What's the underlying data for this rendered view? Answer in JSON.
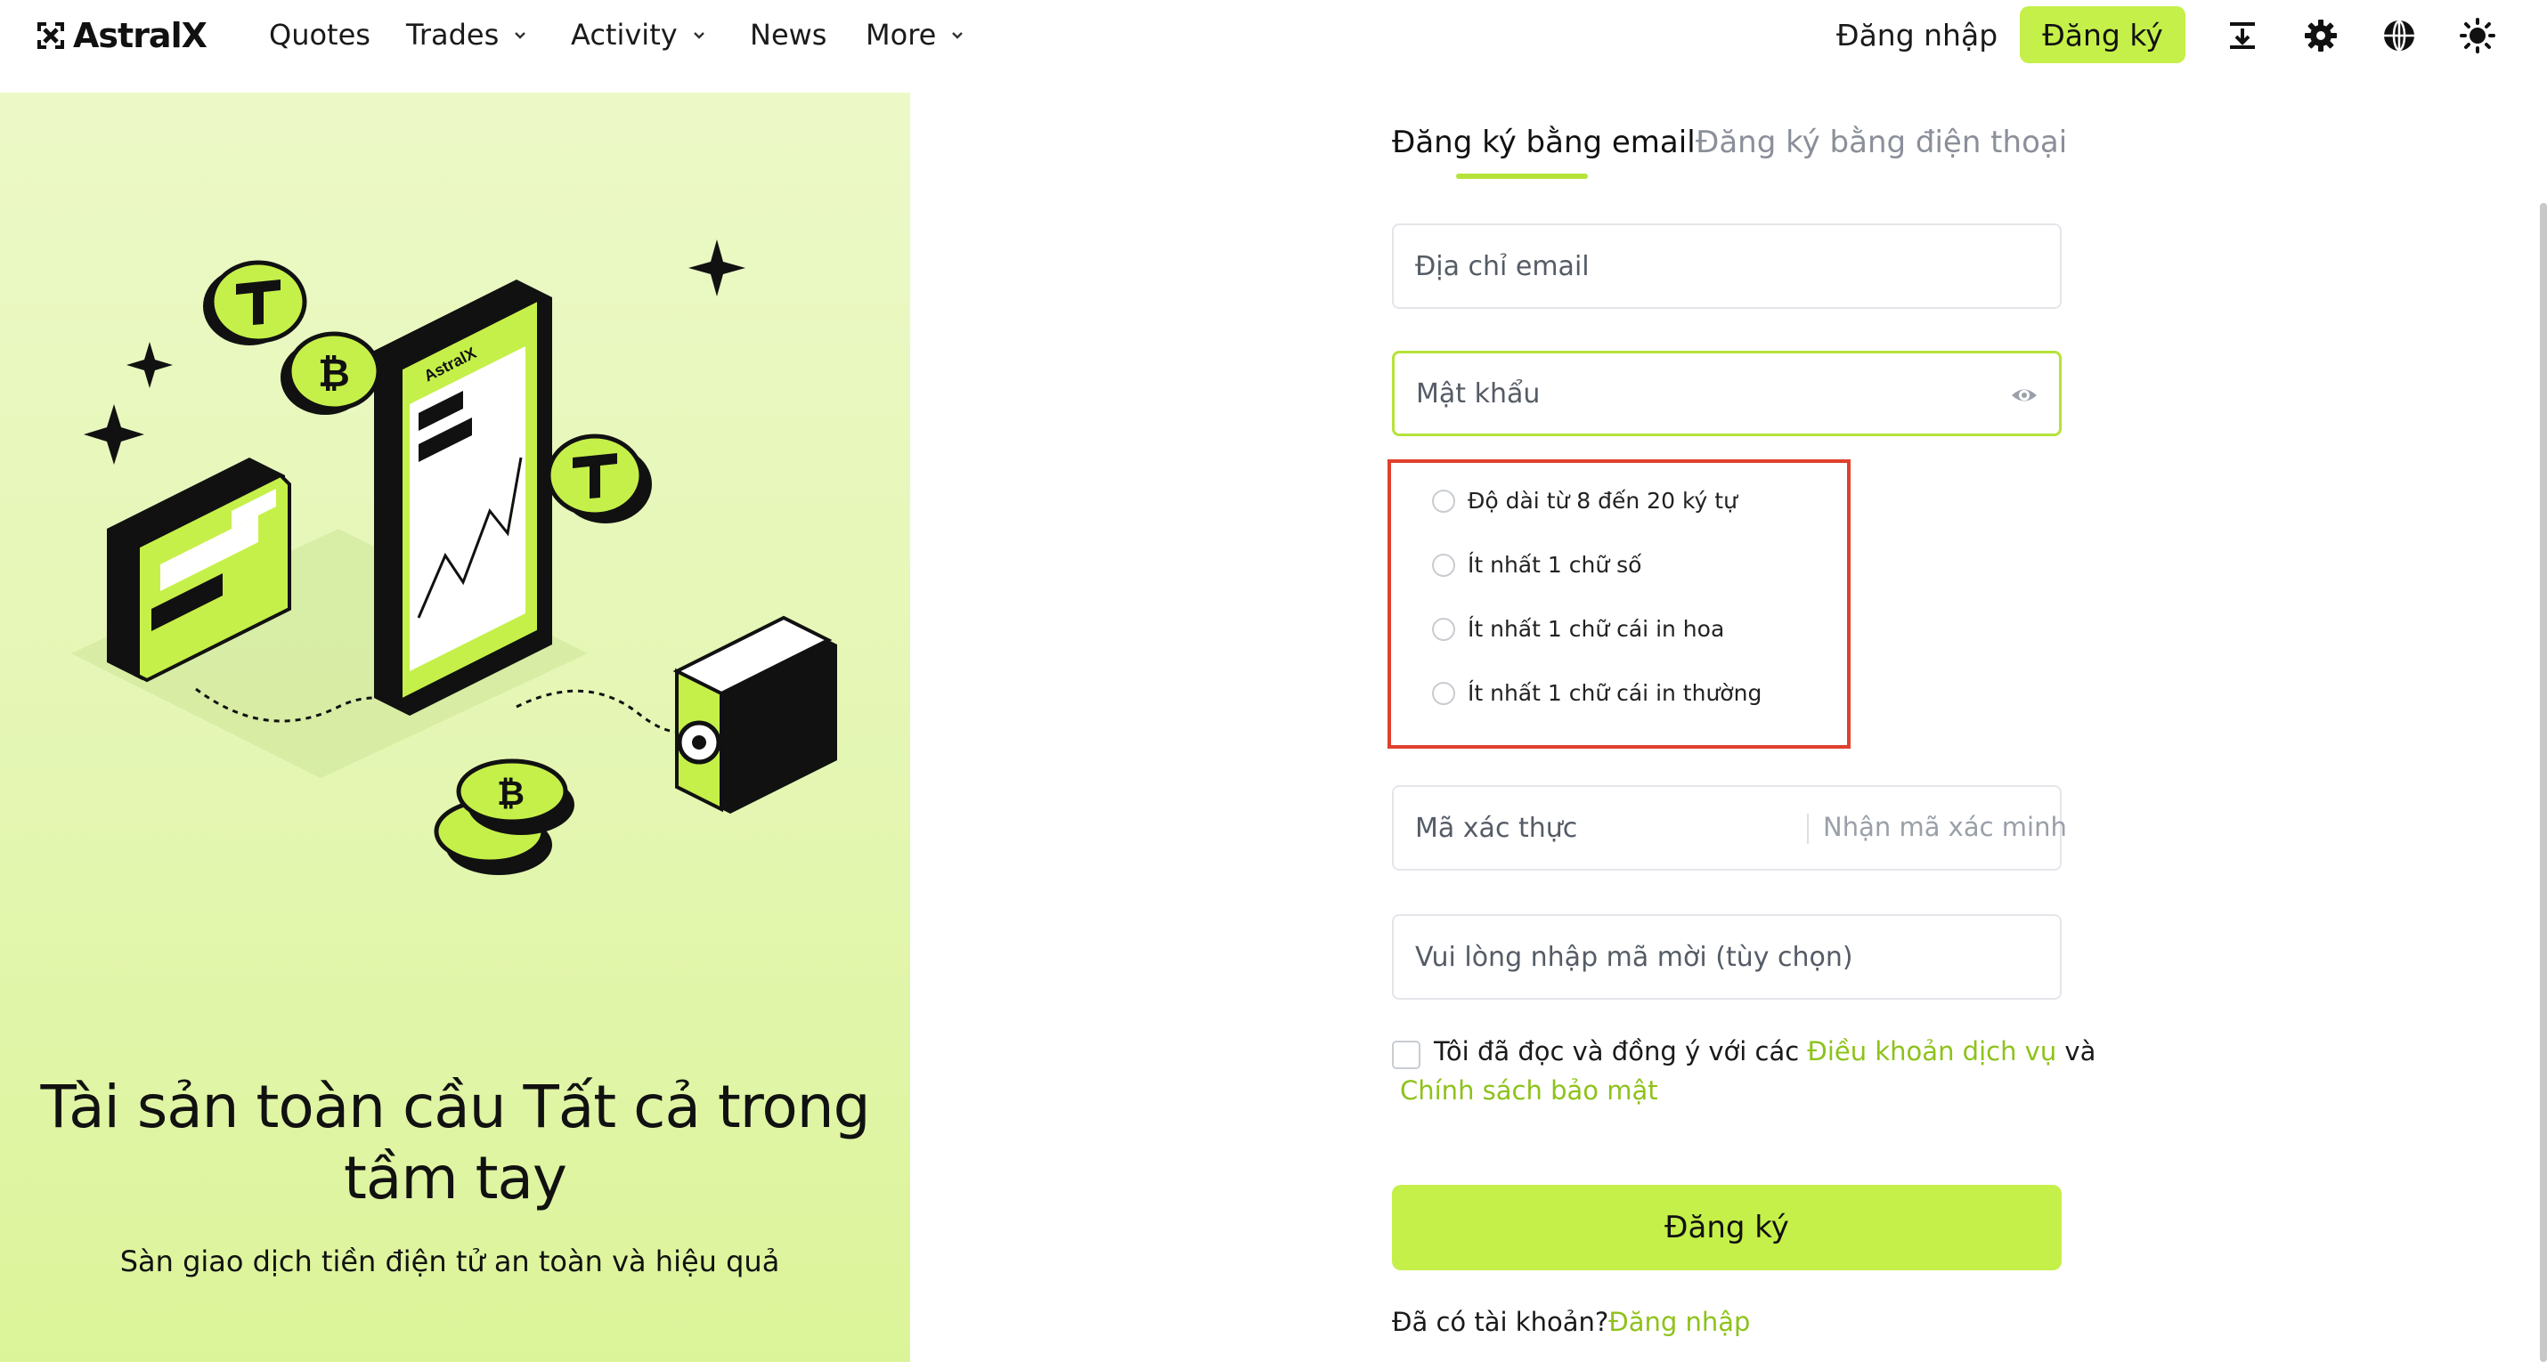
{
  "brand": {
    "name": "AstralX"
  },
  "nav": {
    "links": [
      {
        "label": "Quotes",
        "has_dropdown": false
      },
      {
        "label": "Trades",
        "has_dropdown": true
      },
      {
        "label": "Activity",
        "has_dropdown": true
      },
      {
        "label": "News",
        "has_dropdown": false
      },
      {
        "label": "More",
        "has_dropdown": true
      }
    ],
    "login_label": "Đăng nhập",
    "signup_label": "Đăng ký",
    "icons": [
      "download-icon",
      "gear-icon",
      "globe-icon",
      "theme-icon"
    ]
  },
  "promo": {
    "illustration_label": "AstralX",
    "title": "Tài sản toàn cầu Tất cả trong tầm tay",
    "subtitle": "Sàn giao dịch tiền điện tử an toàn và hiệu quả"
  },
  "form": {
    "tabs": [
      {
        "label": "Đăng ký bằng email",
        "active": true
      },
      {
        "label": "Đăng ký bằng điện thoại",
        "active": false
      }
    ],
    "email_placeholder": "Địa chỉ email",
    "password_placeholder": "Mật khẩu",
    "password_rules": [
      "Độ dài từ 8 đến 20 ký tự",
      "Ít nhất 1 chữ số",
      "Ít nhất 1 chữ cái in hoa",
      "Ít nhất 1 chữ cái in thường"
    ],
    "code_placeholder": "Mã xác thực",
    "get_code_label": "Nhận mã xác minh",
    "invite_placeholder": "Vui lòng nhập mã mời (tùy chọn)",
    "agree_prefix": "Tôi đã đọc và đồng ý với các ",
    "terms_link": "Điều khoản dịch vụ",
    "agree_and": " và",
    "privacy_link": "Chính sách bảo mật",
    "submit_label": "Đăng ký",
    "have_account": "Đã có tài khoản?",
    "login_link": "Đăng nhập"
  },
  "colors": {
    "accent": "#c5f04a",
    "link": "#8ec21a",
    "highlight_box": "#e0402e"
  }
}
